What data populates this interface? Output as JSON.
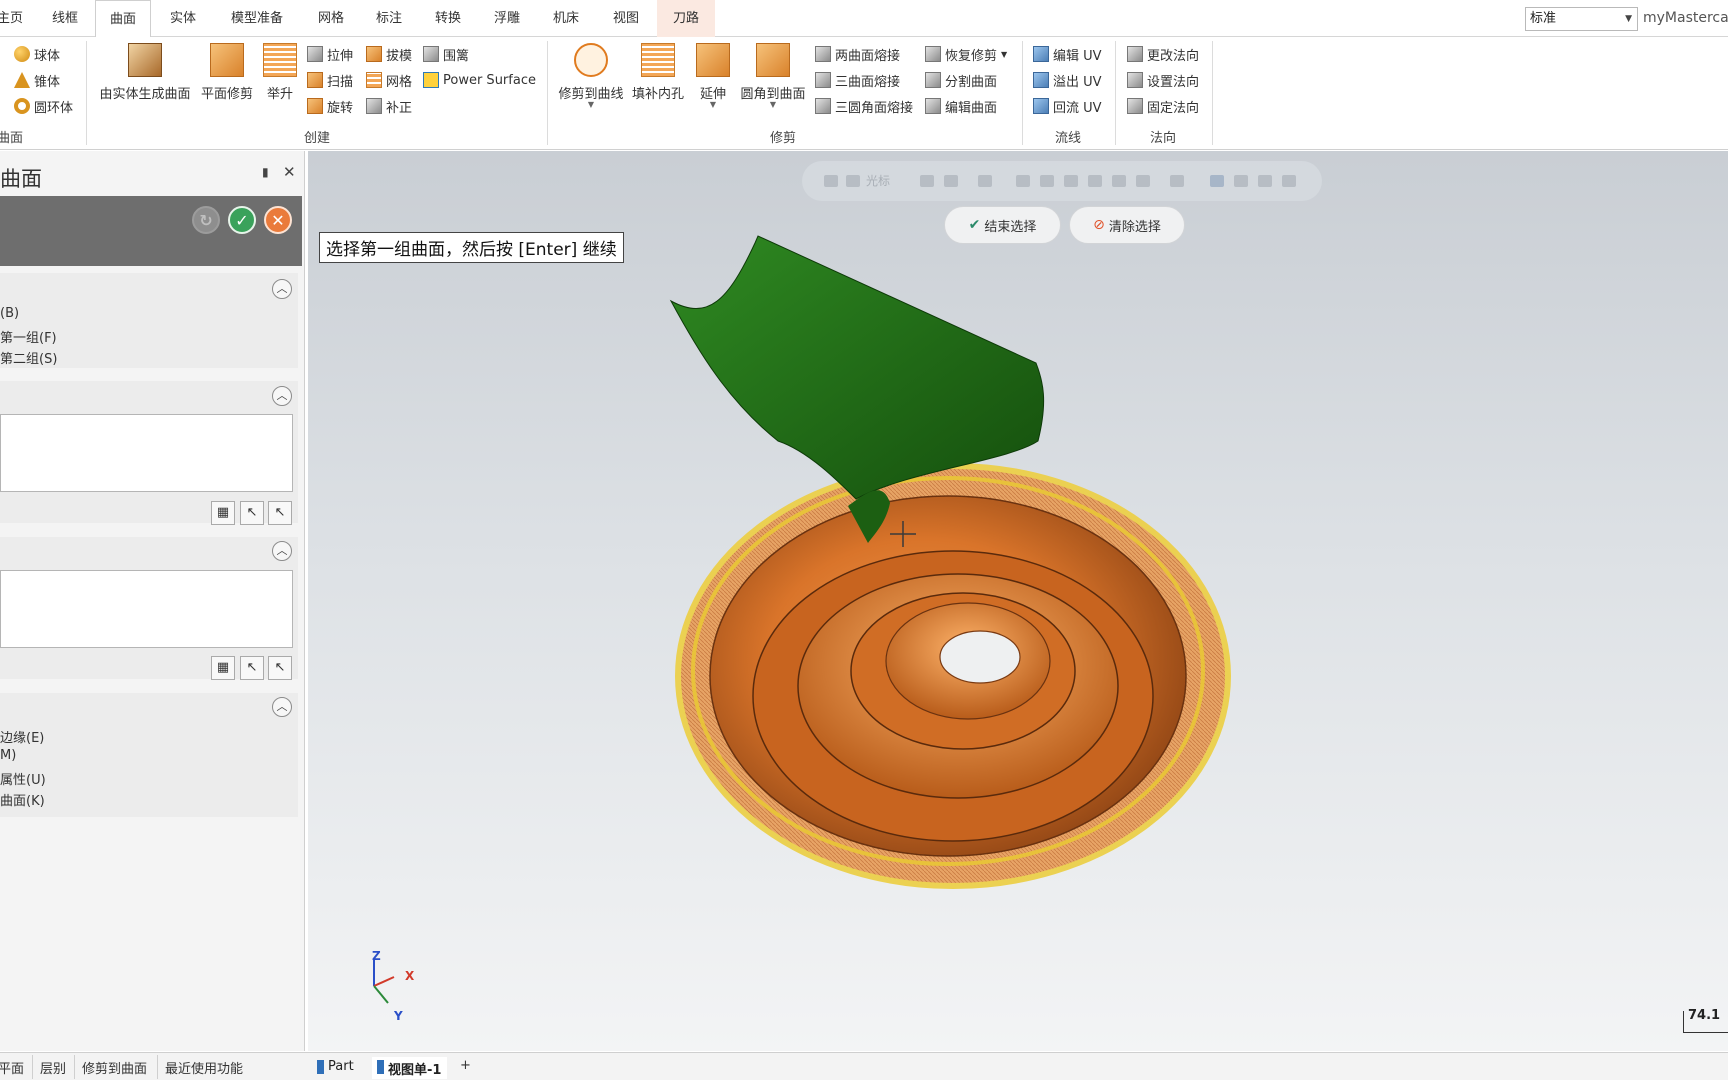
{
  "tabs": [
    {
      "label": "主页"
    },
    {
      "label": "线框"
    },
    {
      "label": "曲面"
    },
    {
      "label": "实体"
    },
    {
      "label": "模型准备"
    },
    {
      "label": "网格"
    },
    {
      "label": "标注"
    },
    {
      "label": "转换"
    },
    {
      "label": "浮雕"
    },
    {
      "label": "机床"
    },
    {
      "label": "视图"
    },
    {
      "label": "刀路"
    }
  ],
  "mode_select": {
    "value": "标准"
  },
  "brand": "myMastercam",
  "ribbon": {
    "basic": {
      "sphere": "球体",
      "cone": "锥体",
      "torus": "圆环体",
      "group": "曲面"
    },
    "create": {
      "from_solid": "由实体生成曲面",
      "flat_trim": "平面修剪",
      "loft": "举升",
      "extrude": "拉伸",
      "draft": "拔模",
      "fence": "围篱",
      "sweep": "扫描",
      "net": "网格",
      "power_surface": "Power Surface",
      "revolve": "旋转",
      "patch": "补正",
      "group": "创建"
    },
    "trim": {
      "trim_to_curve": "修剪到曲线",
      "fill_holes": "填补内孔",
      "extend": "延伸",
      "fillet_to_surface": "圆角到曲面",
      "two_blend": "两曲面熔接",
      "three_blend": "三曲面熔接",
      "three_fillet_blend": "三圆角面熔接",
      "recover_trim": "恢复修剪",
      "split_surface": "分割曲面",
      "edit_surface": "编辑曲面",
      "group": "修剪"
    },
    "flowline": {
      "edit_uv": "编辑 UV",
      "overflow_uv": "溢出 UV",
      "reflow_uv": "回流 UV",
      "group": "流线"
    },
    "normal": {
      "change": "更改法向",
      "set": "设置法向",
      "fix": "固定法向",
      "group": "法向"
    }
  },
  "panel": {
    "title": "曲面",
    "options1": [
      "(B)",
      "第一组(F)",
      "第二组(S)"
    ],
    "options2": [
      "边缘(E)",
      "M)",
      "属性(U)",
      "曲面(K)"
    ]
  },
  "viewport": {
    "prompt": "选择第一组曲面，然后按 [Enter] 继续",
    "quickbar_label": "光标",
    "end_select": "结束选择",
    "clear_select": "清除选择",
    "scale_value": "74.1"
  },
  "axes": {
    "z": "Z",
    "x": "X",
    "y": "Y"
  },
  "bottom": {
    "tabs": [
      "平面",
      "层别",
      "修剪到曲面",
      "最近使用功能"
    ],
    "view_tabs": [
      "Part",
      "视图单-1"
    ],
    "add": "+"
  },
  "colors": {
    "accent_tab_toolpath": "#fbe9e1",
    "part_orange": "#d9742a",
    "surface_green": "#1e6b14",
    "highlight_yellow": "#e3c235"
  }
}
